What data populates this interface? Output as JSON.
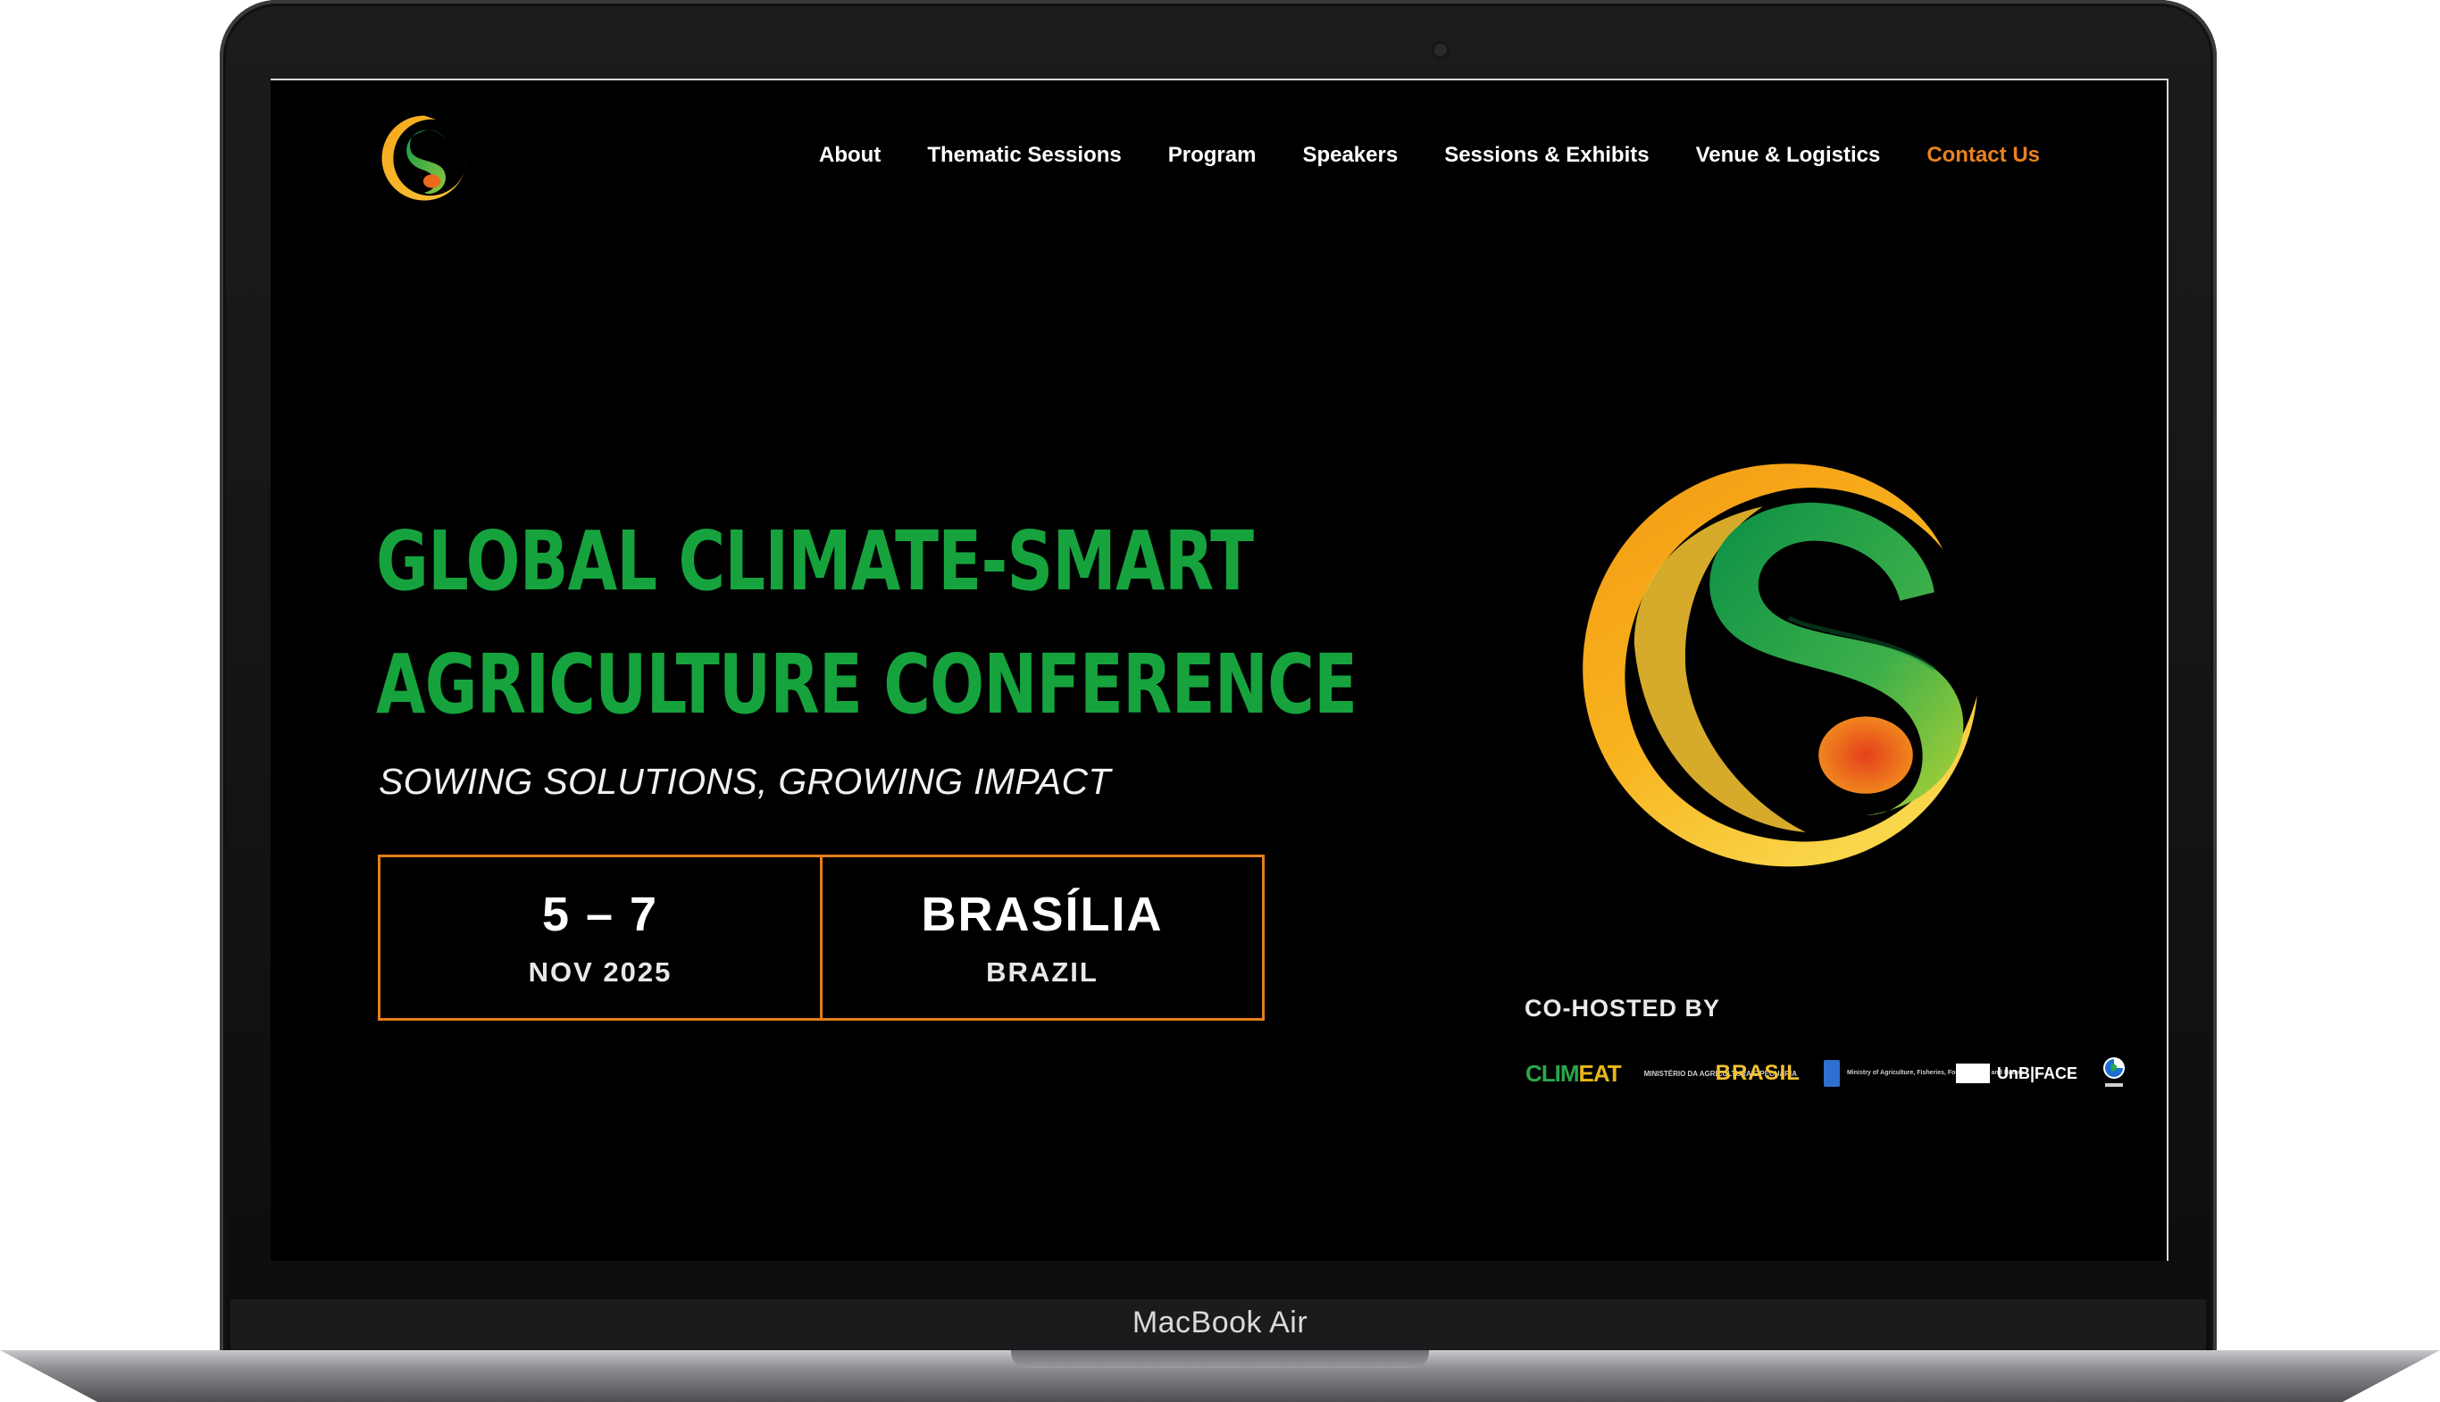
{
  "device": {
    "model_label": "MacBook Air"
  },
  "nav": {
    "logo_icon": "conference-logo-icon",
    "items": [
      {
        "label": "About"
      },
      {
        "label": "Thematic Sessions"
      },
      {
        "label": "Program"
      },
      {
        "label": "Speakers"
      },
      {
        "label": "Sessions & Exhibits"
      },
      {
        "label": "Venue & Logistics"
      },
      {
        "label": "Contact Us",
        "accent": "#e9821f"
      }
    ]
  },
  "hero": {
    "title_line1": "GLOBAL CLIMATE-SMART",
    "title_line2": "AGRICULTURE CONFERENCE",
    "tagline": "SOWING SOLUTIONS, GROWING IMPACT",
    "date_main": "5 – 7",
    "date_sub": "NOV 2025",
    "location_main": "BRASÍLIA",
    "location_sub": "BRAZIL"
  },
  "cohost": {
    "label": "CO-HOSTED BY",
    "partners": {
      "climeat_a": "CLIM",
      "climeat_b": "EAT",
      "ministry_small": "MINISTÉRIO DA AGRICULTURA E PECUÁRIA",
      "brasil": "BRASIL",
      "mapa_small": "Ministry of Agriculture, Fisheries, Food Security and Nature",
      "unb": "UnB|FACE"
    }
  },
  "colors": {
    "title_green": "#16a33e",
    "accent_orange": "#e57e1c",
    "background": "#000000"
  }
}
